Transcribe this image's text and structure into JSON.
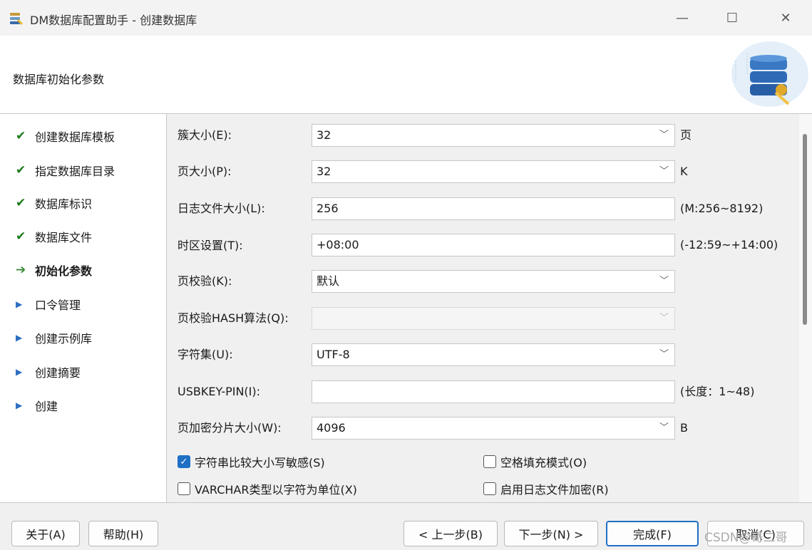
{
  "window": {
    "title": "DM数据库配置助手 - 创建数据库",
    "min_glyph": "—",
    "max_glyph": "☐",
    "close_glyph": "✕"
  },
  "header": {
    "title": "数据库初始化参数"
  },
  "steps": [
    {
      "label": "创建数据库模板",
      "state": "done",
      "icon": "✔"
    },
    {
      "label": "指定数据库目录",
      "state": "done",
      "icon": "✔"
    },
    {
      "label": "数据库标识",
      "state": "done",
      "icon": "✔"
    },
    {
      "label": "数据库文件",
      "state": "done",
      "icon": "✔"
    },
    {
      "label": "初始化参数",
      "state": "current",
      "icon": "➔"
    },
    {
      "label": "口令管理",
      "state": "pending",
      "icon": "▶"
    },
    {
      "label": "创建示例库",
      "state": "pending",
      "icon": "▶"
    },
    {
      "label": "创建摘要",
      "state": "pending",
      "icon": "▶"
    },
    {
      "label": "创建",
      "state": "pending",
      "icon": "▶"
    }
  ],
  "form": {
    "extent_size": {
      "label": "簇大小(E):",
      "value": "32",
      "suffix": "页"
    },
    "page_size": {
      "label": "页大小(P):",
      "value": "32",
      "suffix": "K"
    },
    "log_size": {
      "label": "日志文件大小(L):",
      "value": "256",
      "suffix": "(M:256~8192)"
    },
    "time_zone": {
      "label": "时区设置(T):",
      "value": "+08:00",
      "suffix": "(-12:59~+14:00)"
    },
    "page_check": {
      "label": "页校验(K):",
      "value": "默认"
    },
    "page_check_hash": {
      "label": "页校验HASH算法(Q):",
      "value": ""
    },
    "charset": {
      "label": "字符集(U):",
      "value": "UTF-8"
    },
    "usbkey_pin": {
      "label": "USBKEY-PIN(I):",
      "value": "",
      "suffix": "(长度：1~48)"
    },
    "encrypt_slice": {
      "label": "页加密分片大小(W):",
      "value": "4096",
      "suffix": "B"
    }
  },
  "checkboxes": {
    "case_sensitive": {
      "label": "字符串比较大小写敏感(S)",
      "checked": true
    },
    "blank_pad": {
      "label": "空格填充模式(O)",
      "checked": false
    },
    "varchar_char": {
      "label": "VARCHAR类型以字符为单位(X)",
      "checked": false
    },
    "log_encrypt": {
      "label": "启用日志文件加密(R)",
      "checked": false
    }
  },
  "buttons": {
    "about": "关于(A)",
    "help": "帮助(H)",
    "prev": "< 上一步(B)",
    "next": "下一步(N) >",
    "finish": "完成(F)",
    "cancel": "取消(C)"
  },
  "watermark": "CSDN@哥二哥",
  "chevron_glyph": "﹀",
  "check_glyph": "✓",
  "colors": {
    "accent": "#1f6fc5",
    "done": "#1a7a1a",
    "pending": "#2c6fc0"
  }
}
